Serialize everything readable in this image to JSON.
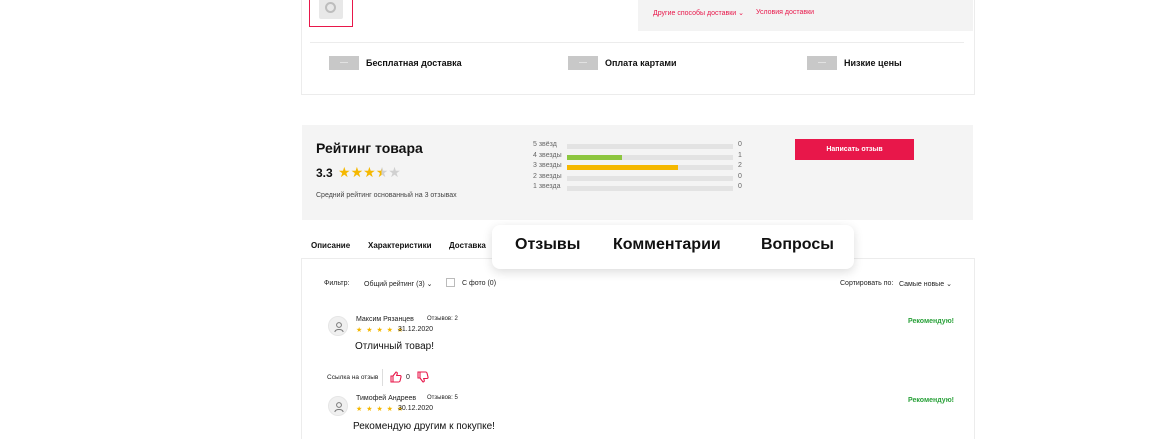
{
  "delivery": {
    "other_methods": "Другие способы доставки",
    "conditions": "Условия доставки"
  },
  "features": [
    {
      "label": "Бесплатная доставка"
    },
    {
      "label": "Оплата картами"
    },
    {
      "label": "Низкие цены"
    }
  ],
  "rating": {
    "title": "Рейтинг товара",
    "average": "3.3",
    "stars_value": 3.3,
    "subtitle": "Средний рейтинг основанный на 3 отзывах",
    "distribution": [
      {
        "label": "5 звёзд",
        "count": "0",
        "fraction": 0,
        "color": "#e3e3e3"
      },
      {
        "label": "4 звезды",
        "count": "1",
        "fraction": 0.33,
        "color": "#8dc63f"
      },
      {
        "label": "3 звезды",
        "count": "2",
        "fraction": 0.67,
        "color": "#f5b800"
      },
      {
        "label": "2 звезды",
        "count": "0",
        "fraction": 0,
        "color": "#e3e3e3"
      },
      {
        "label": "1 звезда",
        "count": "0",
        "fraction": 0,
        "color": "#e3e3e3"
      }
    ],
    "write_review_button": "Написать отзыв"
  },
  "tabs_small": [
    "Описание",
    "Характеристики",
    "Доставка"
  ],
  "tabs_big": [
    "Отзывы",
    "Комментарии",
    "Вопросы"
  ],
  "filter": {
    "label": "Фильтр:",
    "rating_select": "Общий рейтинг (3)",
    "photo_label": "С фото (0)",
    "sort_label": "Сортировать по:",
    "sort_value": "Самые новые"
  },
  "reviews": [
    {
      "name": "Максим Рязанцев",
      "reviews_count": "Отзывов: 2",
      "stars": "★ ★ ★ ★ ★",
      "date": "31.12.2020",
      "text": "Отличный товар!",
      "recommend": "Рекомендую!"
    },
    {
      "name": "Тимофей Андреев",
      "reviews_count": "Отзывов: 5",
      "stars": "★ ★ ★ ★ ★",
      "date": "30.12.2020",
      "text": "Рекомендую другим к покупке!",
      "recommend": "Рекомендую!"
    }
  ],
  "review_actions": {
    "link_label": "Ссылка на отзыв",
    "likes": "0"
  },
  "colors": {
    "accent": "#e8174a",
    "success": "#2aa13a",
    "star": "#f5b800"
  }
}
